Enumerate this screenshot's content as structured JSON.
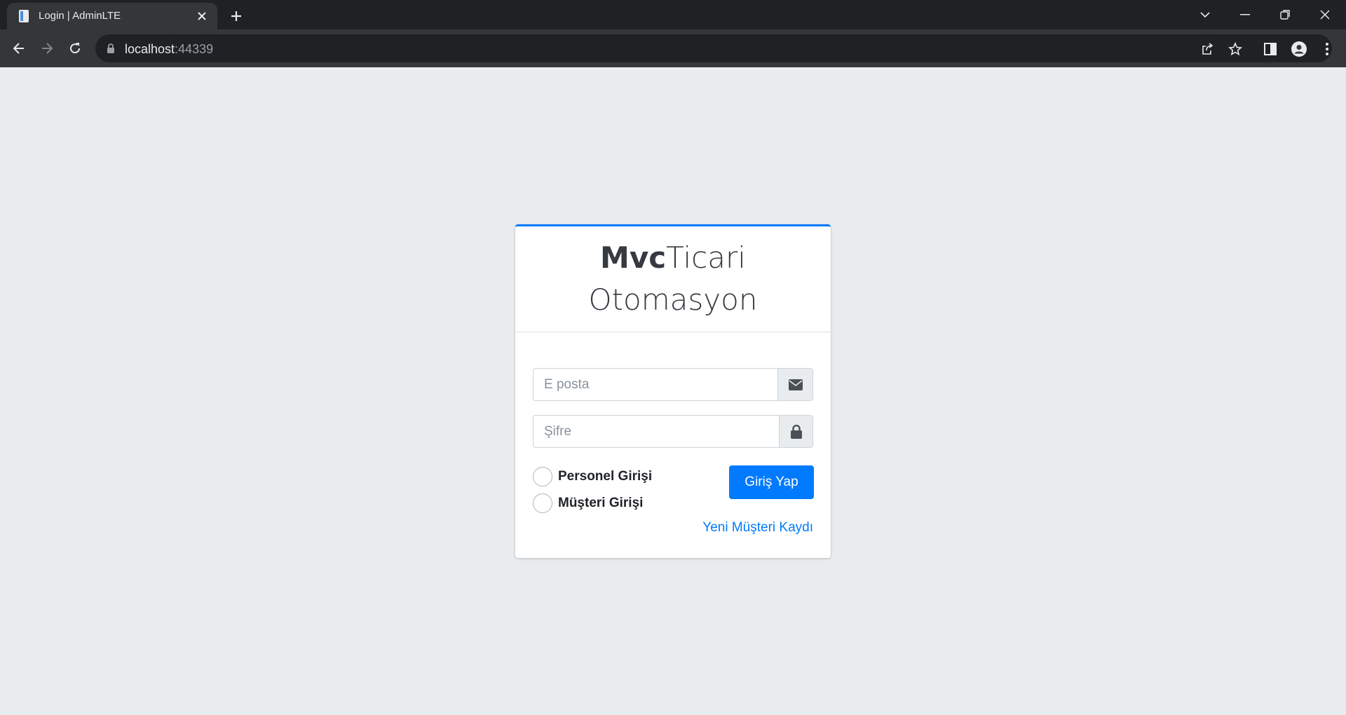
{
  "browser": {
    "tab_title": "Login | AdminLTE",
    "url_host": "localhost",
    "url_port": ":44339"
  },
  "login": {
    "brand_bold": "Mvc",
    "brand_rest_line1": "Ticari",
    "brand_line2": "Otomasyon",
    "email_placeholder": "E posta",
    "password_placeholder": "Şifre",
    "radio_personel": "Personel Girişi",
    "radio_musteri": "Müşteri Girişi",
    "submit_label": "Giriş Yap",
    "register_link": "Yeni Müşteri Kaydı"
  },
  "colors": {
    "accent": "#007bff",
    "page_bg": "#e9ecef"
  }
}
